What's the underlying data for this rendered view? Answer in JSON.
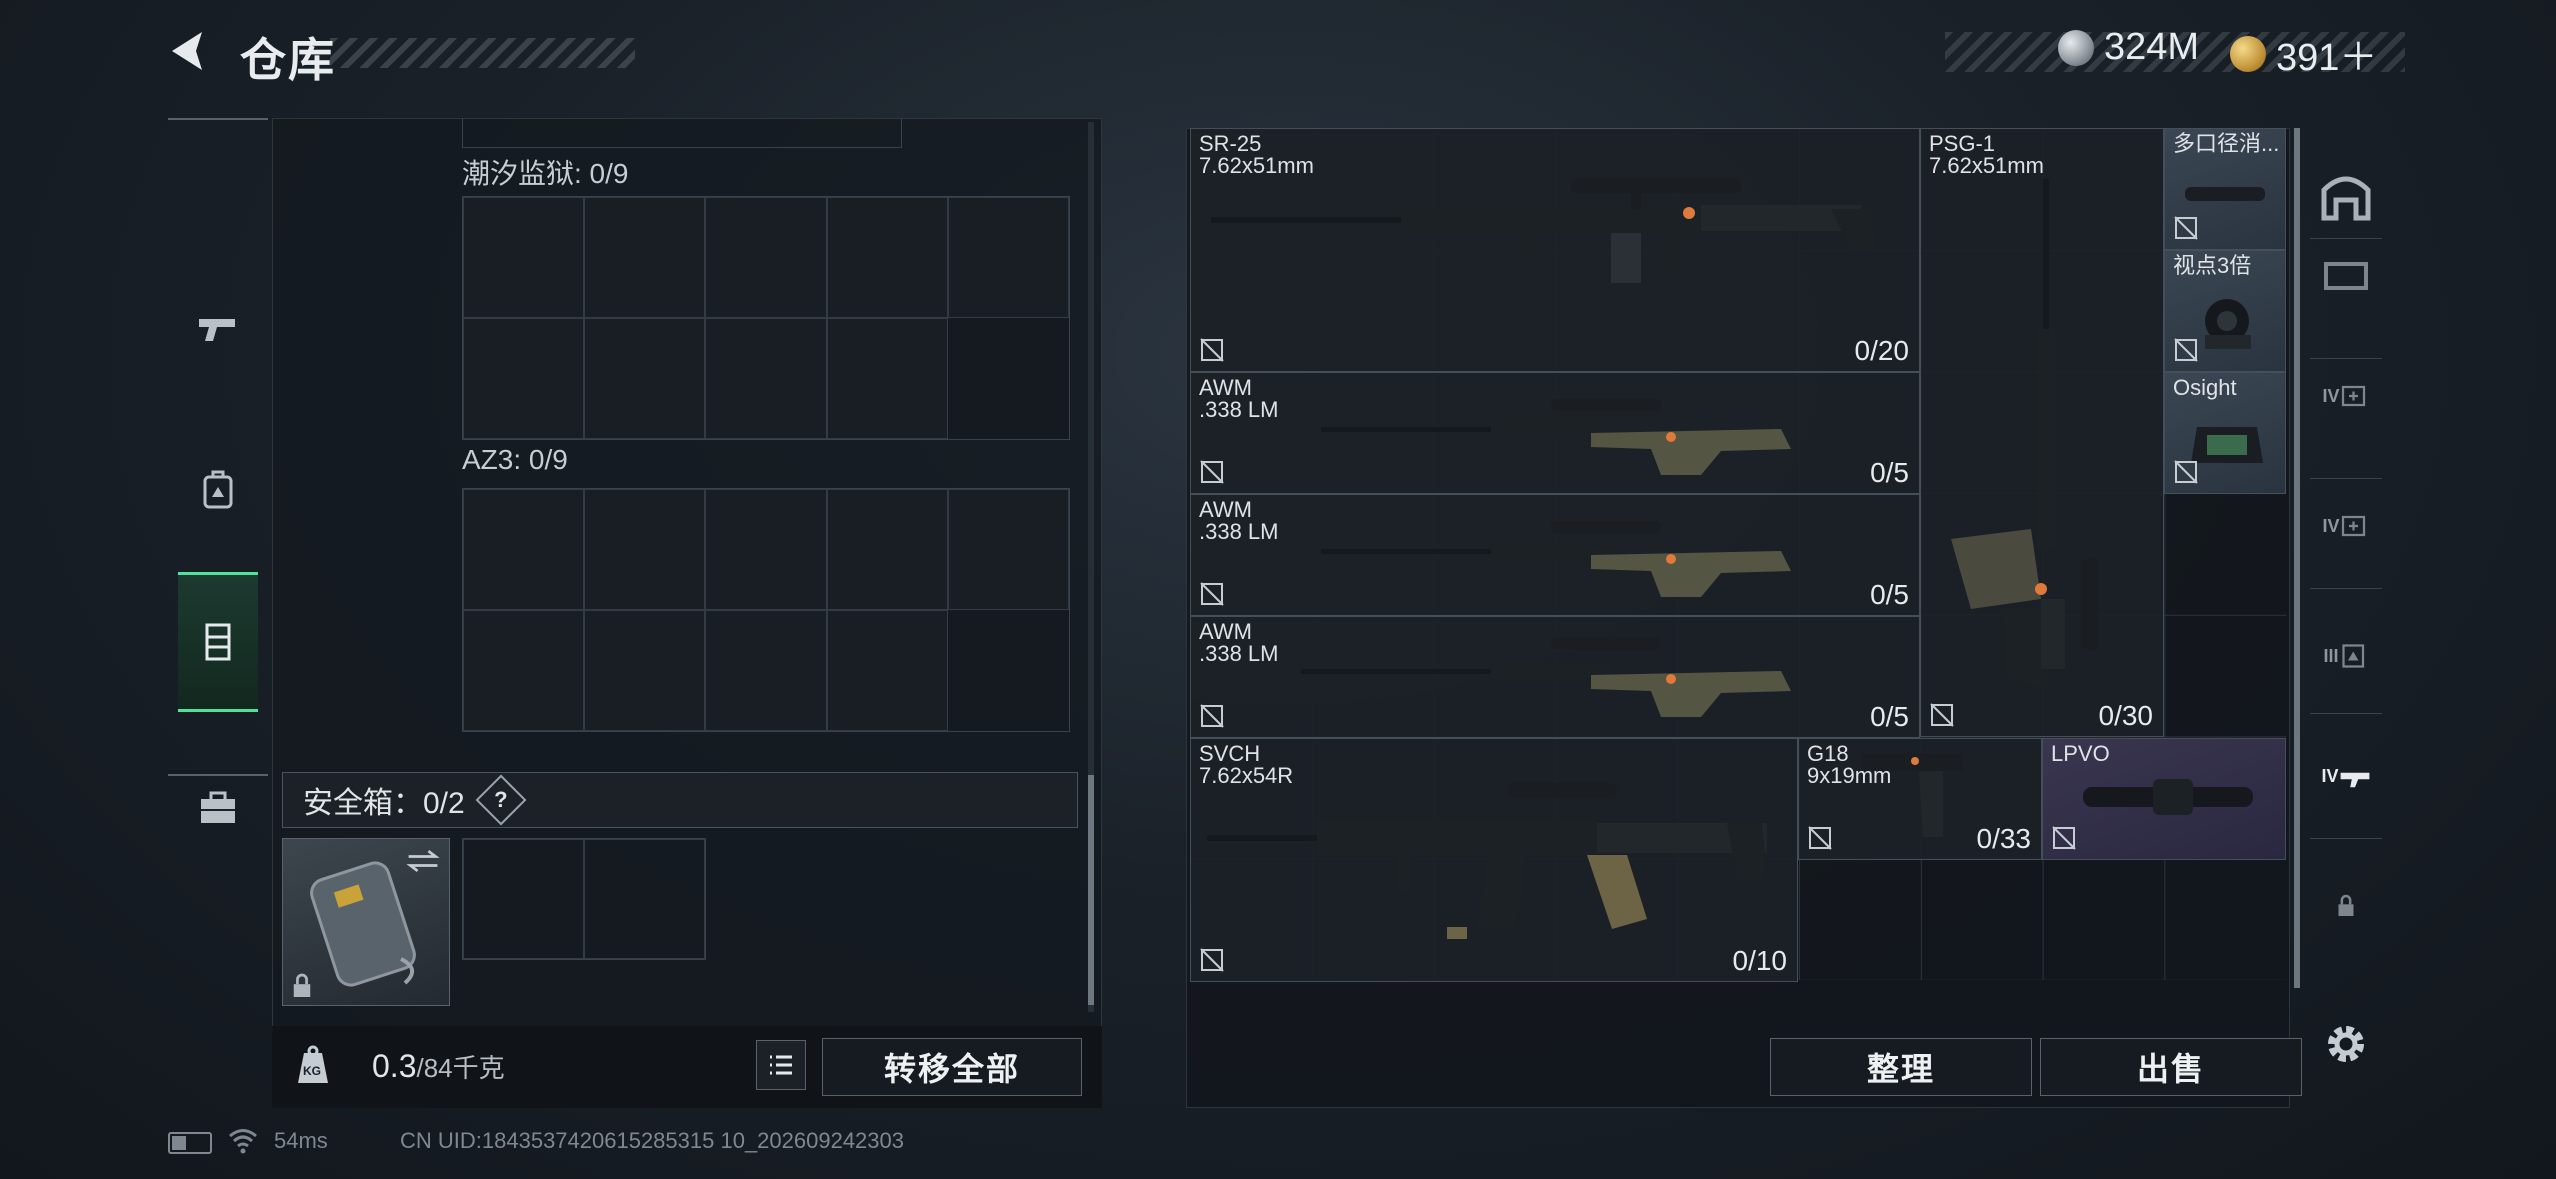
{
  "header": {
    "title": "仓库",
    "currency": [
      {
        "icon": "silver-coin-icon",
        "value": "324M"
      },
      {
        "icon": "gold-coin-icon",
        "value": "391＋"
      }
    ]
  },
  "left_tabs": [
    {
      "icon": "pistol-icon"
    },
    {
      "icon": "backpack-icon"
    },
    {
      "icon": "vest-icon",
      "active": true
    },
    {
      "icon": "briefcase-icon"
    }
  ],
  "containers": [
    {
      "label": "潮汐监狱: 0/9"
    },
    {
      "label": "AZ3: 0/9"
    }
  ],
  "safe_box": {
    "label": "安全箱：0/2",
    "help": "?"
  },
  "footer_left": {
    "weight_value": "0.3",
    "weight_max": "/84千克",
    "transfer_all": "转移全部"
  },
  "stash_items": [
    {
      "name": "SR-25\n7.62x51mm",
      "count": "0/20"
    },
    {
      "name": "PSG-1\n7.62x51mm",
      "count": "0/30"
    },
    {
      "name": "多口径消..."
    },
    {
      "name": "视点3倍"
    },
    {
      "name": "Osight"
    },
    {
      "name": "AWM\n.338 LM",
      "count": "0/5"
    },
    {
      "name": "AWM\n.338 LM",
      "count": "0/5"
    },
    {
      "name": "AWM\n.338 LM",
      "count": "0/5"
    },
    {
      "name": "SVCH\n7.62x54R",
      "count": "0/10"
    },
    {
      "name": "G18\n9x19mm",
      "count": "0/33"
    },
    {
      "name": "LPVO"
    }
  ],
  "right_tabs": {
    "labels": [
      "IV",
      "IV",
      "III",
      "IV"
    ]
  },
  "actions": {
    "sort": "整理",
    "sell": "出售"
  },
  "status_bar": {
    "ping": "54ms",
    "uid": "CN UID:1843537420615285315 10_202609242303"
  }
}
